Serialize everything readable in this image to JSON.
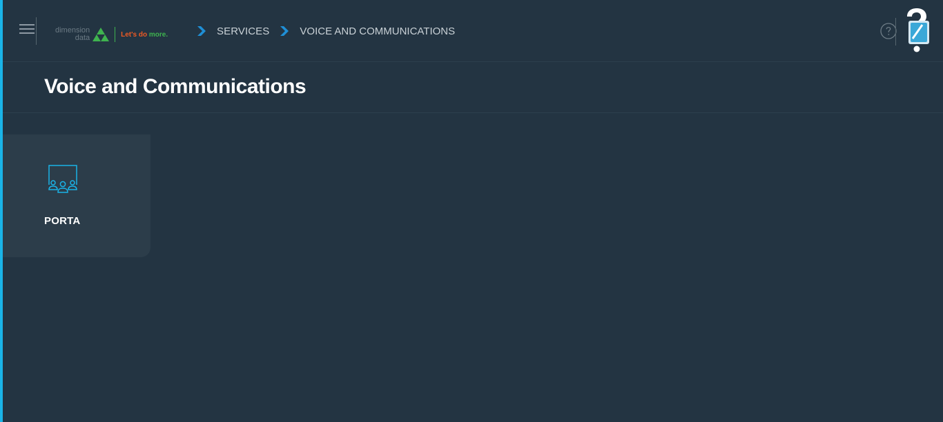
{
  "header": {
    "logo": {
      "line1": "dimension",
      "line2": "data",
      "tagline_a": "Let's do ",
      "tagline_b": "more."
    },
    "breadcrumb": {
      "items": [
        {
          "label": "SERVICES"
        },
        {
          "label": "VOICE AND COMMUNICATIONS"
        }
      ]
    }
  },
  "page": {
    "title": "Voice and Communications"
  },
  "tiles": [
    {
      "label": "PORTA",
      "icon": "presentation-audience-icon"
    }
  ],
  "colors": {
    "background": "#233442",
    "accent": "#1ab4e8",
    "tile": "#2c3d4a",
    "chevron": "#1f8fd6"
  }
}
